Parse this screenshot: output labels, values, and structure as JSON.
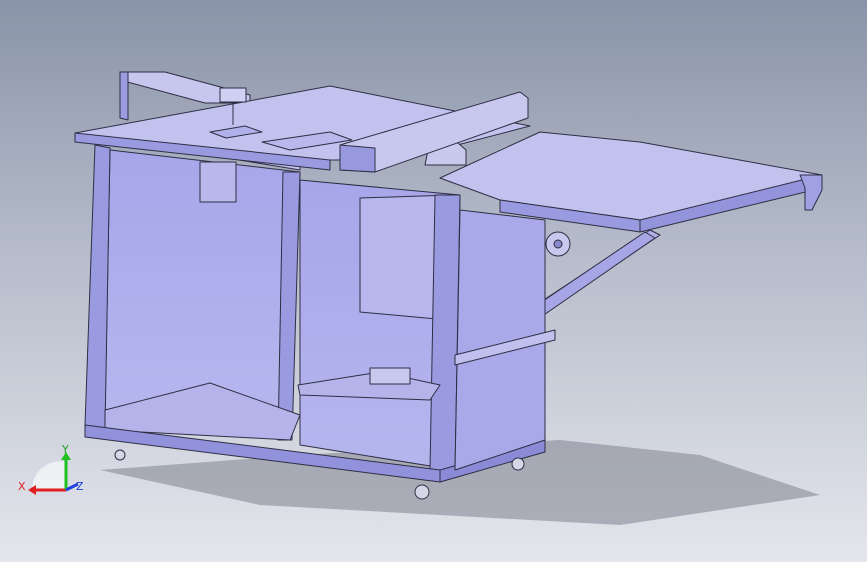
{
  "viewport": {
    "background_top": "#8a94a8",
    "background_bottom": "#e4e6ec"
  },
  "model": {
    "body_color": "#aaaaeb",
    "top_color": "#b5b5ea",
    "edge_color": "#2e2e45",
    "shadow_color": "#7b7f8c"
  },
  "triad": {
    "x_label": "X",
    "y_label": "Y",
    "z_label": "Z",
    "x_color": "#e02020",
    "y_color": "#20c020",
    "z_color": "#2040e0"
  }
}
